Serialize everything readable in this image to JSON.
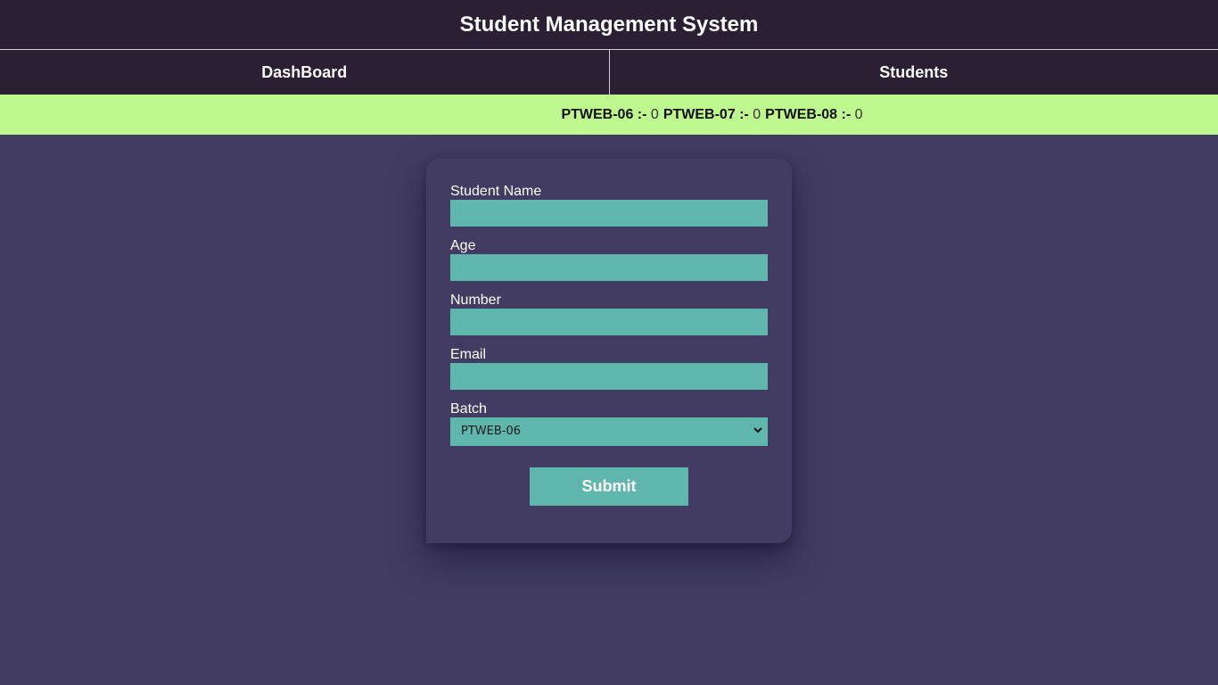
{
  "app": {
    "title": "Student Management System"
  },
  "nav": {
    "dashboard_label": "DashBoard",
    "students_label": "Students"
  },
  "stats": [
    {
      "label": "PTWEB-06 :-",
      "value": "0"
    },
    {
      "label": "PTWEB-07 :-",
      "value": "0"
    },
    {
      "label": "PTWEB-08 :-",
      "value": "0"
    }
  ],
  "form": {
    "name_label": "Student Name",
    "name_value": "",
    "age_label": "Age",
    "age_value": "",
    "number_label": "Number",
    "number_value": "",
    "email_label": "Email",
    "email_value": "",
    "batch_label": "Batch",
    "batch_selected": "PTWEB-06",
    "submit_label": "Submit"
  },
  "icons": {
    "select_arrow": "chevron-down-icon"
  },
  "colors": {
    "header_bg": "#2b1f33",
    "page_bg": "#423c63",
    "stats_bg": "#bff88f",
    "input_bg": "#5eb6ad",
    "text_light": "#ffffff"
  }
}
